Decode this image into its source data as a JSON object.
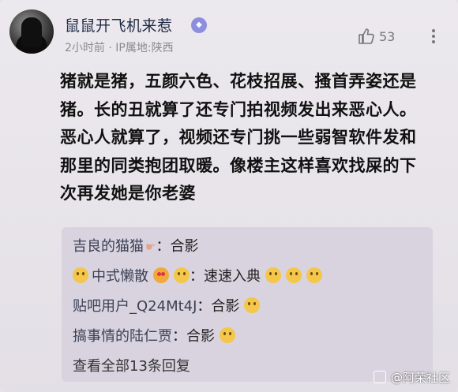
{
  "header": {
    "username": "鼠鼠开飞机来惹",
    "time": "2小时前",
    "separator": "·",
    "ip_location": "IP属地:陕西",
    "like_count": "53",
    "icons": {
      "like": "thumbs-up-icon",
      "more": "more-vertical-icon",
      "badge": "vip-badge-icon"
    }
  },
  "post": {
    "lines": [
      "猪就是猪，五颜六色、花枝招展、搔首弄姿还是",
      "猪。长的丑就算了还专门拍视频发出来恶心人。",
      "恶心人就算了，视频还专门挑一些弱智软件发和",
      "那里的同类抱团取暖。像楼主这样喜欢找屎的下",
      "次再发她是你老婆"
    ]
  },
  "replies": [
    {
      "name": "吉良的猫猫",
      "text": "合影"
    },
    {
      "name": "中式懒散",
      "text": "速速入典"
    },
    {
      "name": "贴吧用户_Q24Mt4J",
      "text": "合影"
    },
    {
      "name": "搞事情的陆仁贾",
      "text": "合影"
    }
  ],
  "colon": "：",
  "view_all": "查看全部13条回复",
  "watermark": "@阿荣社区"
}
